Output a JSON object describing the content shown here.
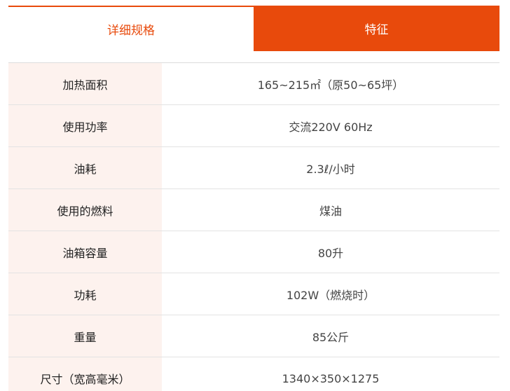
{
  "tabs": {
    "specs_label": "详细规格",
    "features_label": "特征"
  },
  "colors": {
    "accent": "#e84a0c",
    "label_bg": "#fdf2ee"
  },
  "specs": [
    {
      "label": "加热面积",
      "value": "165~215㎡（原50~65坪）"
    },
    {
      "label": "使用功率",
      "value": "交流220V 60Hz"
    },
    {
      "label": "油耗",
      "value": "2.3ℓ/小时"
    },
    {
      "label": "使用的燃料",
      "value": "煤油"
    },
    {
      "label": "油箱容量",
      "value": "80升"
    },
    {
      "label": "功耗",
      "value": "102W（燃烧时）"
    },
    {
      "label": "重量",
      "value": "85公斤"
    },
    {
      "label": "尺寸（宽高毫米）",
      "value": "1340×350×1275"
    }
  ]
}
